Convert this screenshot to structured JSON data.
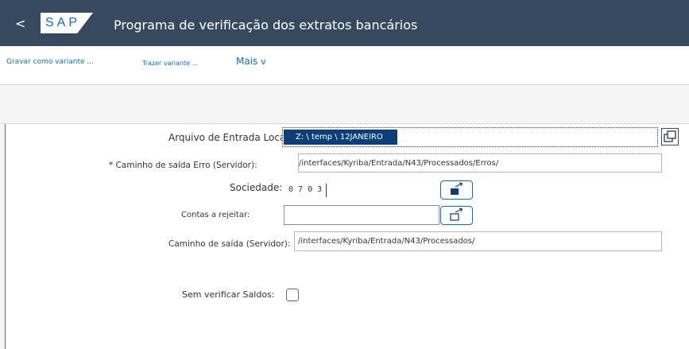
{
  "shell": {
    "back_label": "<",
    "logo_text": "SAP",
    "title": "Programa de verificação dos extratos bancários"
  },
  "toolbar": {
    "save_variant": "Gravar como variante ...",
    "get_variant": "Trazer variante ...",
    "more": "Mais"
  },
  "form": {
    "input_file": {
      "label": "Arquivo de Entrada Local:",
      "value": "Z: \\ temp \\ 12JANEIRO"
    },
    "error_path": {
      "label": "* Caminho de saída Erro (Servidor):",
      "value": "/interfaces/Kyriba/Entrada/N43/Processados/Erros/"
    },
    "company": {
      "label": "Sociedade:",
      "value": "0 7 0 3"
    },
    "reject_accounts": {
      "label": "Contas a rejeitar:",
      "value": ""
    },
    "output_path": {
      "label": "Caminho de saída (Servidor):",
      "value": "/interfaces/Kyriba/Entrada/N43/Processados/"
    },
    "skip_balances": {
      "label": "Sem verificar Saldos:",
      "checked": false
    }
  },
  "colors": {
    "shell_bg": "#354a5f",
    "accent": "#0a6ed1",
    "selection": "#0a3f7a"
  }
}
